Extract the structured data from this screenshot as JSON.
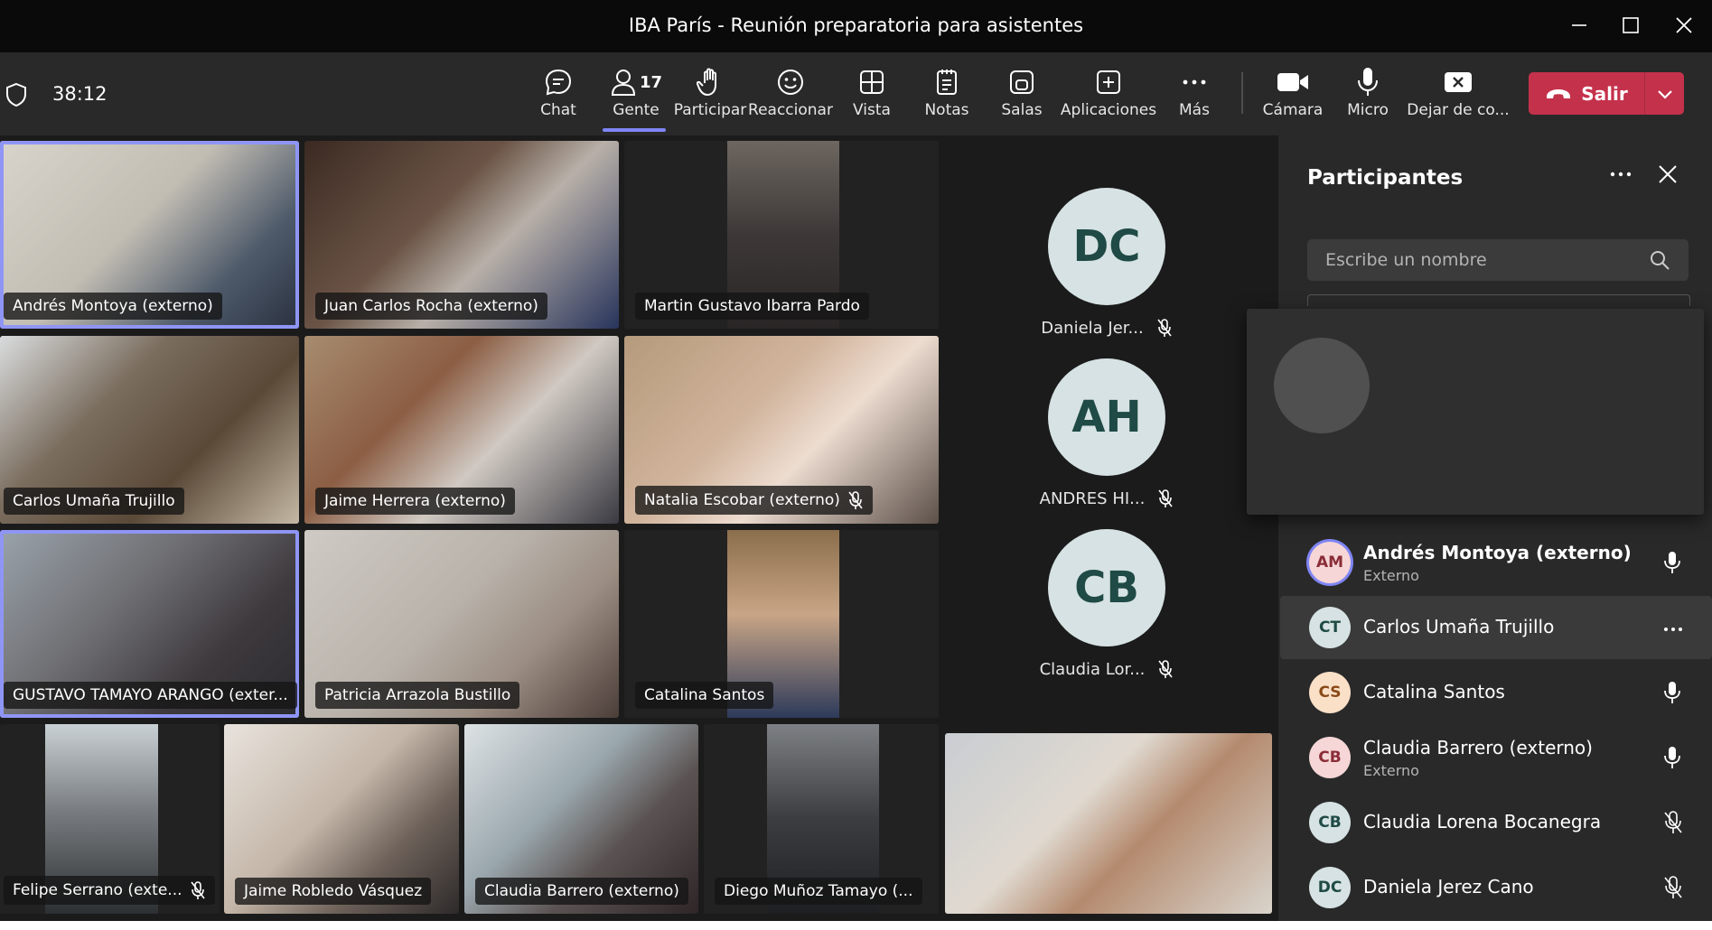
{
  "window": {
    "title": "IBA París - Reunión preparatoria para asistentes"
  },
  "toolbar": {
    "timer": "38:12",
    "chat": "Chat",
    "people": "Gente",
    "people_count": "17",
    "raise": "Participar",
    "react": "Reaccionar",
    "view": "Vista",
    "notes": "Notas",
    "rooms": "Salas",
    "apps": "Aplicaciones",
    "more": "Más",
    "camera": "Cámara",
    "mic": "Micro",
    "share": "Dejar de co...",
    "leave": "Salir"
  },
  "tiles": [
    {
      "name": "Andrés Montoya (externo)",
      "muted": false
    },
    {
      "name": "Juan Carlos Rocha (externo)",
      "muted": false
    },
    {
      "name": "Martin Gustavo Ibarra Pardo",
      "muted": false
    },
    {
      "name": "Carlos Umaña Trujillo",
      "muted": false
    },
    {
      "name": "Jaime Herrera (externo)",
      "muted": false
    },
    {
      "name": "Natalia Escobar (externo)",
      "muted": true
    },
    {
      "name": "GUSTAVO TAMAYO ARANGO (exter...",
      "muted": false
    },
    {
      "name": "Patricia Arrazola Bustillo",
      "muted": false
    },
    {
      "name": "Catalina Santos",
      "muted": false
    },
    {
      "name": "Felipe Serrano (exte...",
      "muted": true
    },
    {
      "name": "Jaime Robledo Vásquez",
      "muted": false
    },
    {
      "name": "Claudia Barrero (externo)",
      "muted": false
    },
    {
      "name": "Diego Muñoz Tamayo (...",
      "muted": false
    }
  ],
  "avatars": [
    {
      "initials": "DC",
      "name": "Daniela Jer..."
    },
    {
      "initials": "AH",
      "name": "ANDRES HI..."
    },
    {
      "initials": "CB",
      "name": "Claudia Lor..."
    }
  ],
  "panel": {
    "title": "Participantes",
    "search_placeholder": "Escribe un nombre",
    "partial_sub": "Externo",
    "items": [
      {
        "initials": "AM",
        "name": "Andrés Montoya (externo)",
        "sub": "Externo"
      },
      {
        "initials": "CT",
        "name": "Carlos Umaña Trujillo",
        "sub": ""
      },
      {
        "initials": "CS",
        "name": "Catalina Santos",
        "sub": ""
      },
      {
        "initials": "CB",
        "name": "Claudia Barrero (externo)",
        "sub": "Externo"
      },
      {
        "initials": "CB",
        "name": "Claudia Lorena Bocanegra",
        "sub": ""
      },
      {
        "initials": "DC",
        "name": "Daniela Jerez Cano",
        "sub": ""
      }
    ]
  },
  "colors": {
    "accent": "#7f85f5",
    "leave": "#c4314b"
  }
}
